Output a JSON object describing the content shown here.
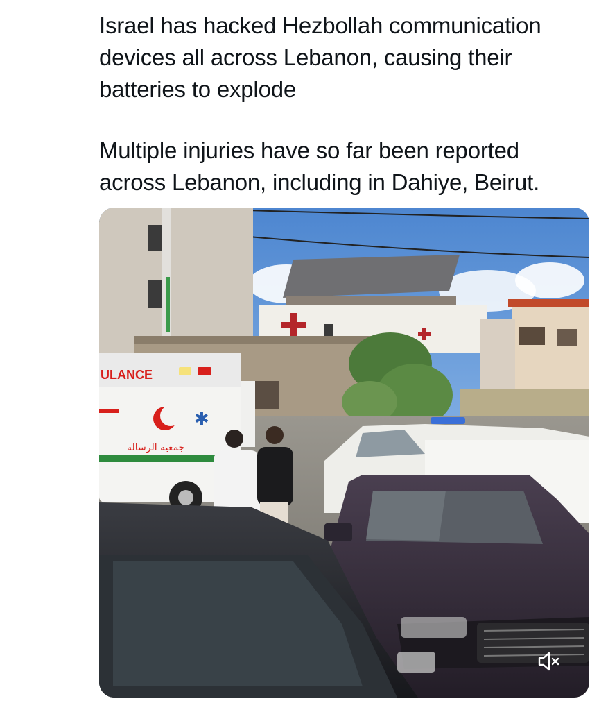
{
  "post": {
    "text_paragraph_1": "Israel has hacked Hezbollah communication\ndevices all across Lebanon, causing their\nbatteries to explode",
    "text_paragraph_2": "Multiple injuries have so far been reported\nacross Lebanon, including in Dahiye, Beirut."
  },
  "video": {
    "ambulance_text": "ULANCE",
    "ambulance_arabic": "جمعية الرسالة",
    "mute_icon": "volume-muted-icon"
  },
  "colors": {
    "text": "#0f1419",
    "sky": "#5f95d6",
    "ambulance_red": "#d8201c",
    "ambulance_green": "#2e8b3e"
  }
}
